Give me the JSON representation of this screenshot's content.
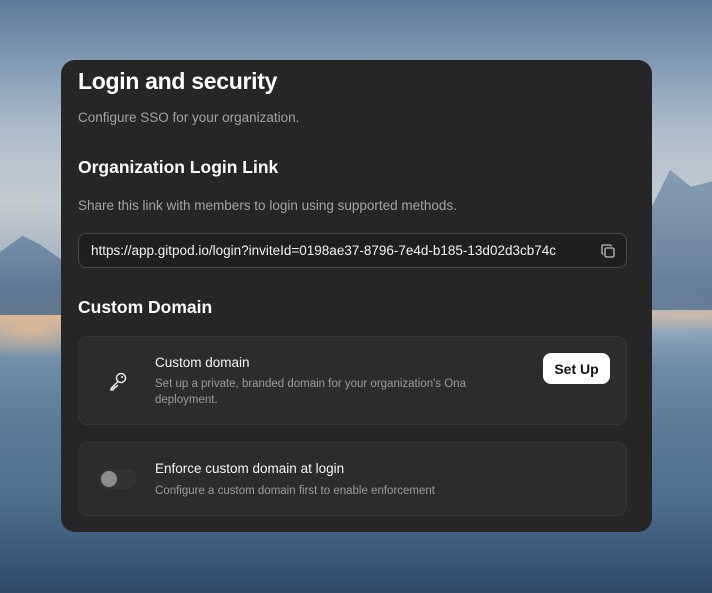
{
  "page": {
    "title": "Login and security",
    "subtitle": "Configure SSO for your organization."
  },
  "login_link": {
    "heading": "Organization Login Link",
    "description": "Share this link with members to login using supported methods.",
    "url": "https://app.gitpod.io/login?inviteId=0198ae37-8796-7e4d-b185-13d02d3cb74c",
    "copy_icon": "copy-icon"
  },
  "custom_domain": {
    "heading": "Custom Domain",
    "card": {
      "icon": "key-icon",
      "title": "Custom domain",
      "description": "Set up a private, branded domain for your organization's Ona deployment.",
      "button_label": "Set Up"
    },
    "enforce": {
      "title": "Enforce custom domain at login",
      "description": "Configure a custom domain first to enable enforcement",
      "enabled": false
    }
  },
  "colors": {
    "card_bg": "#262626",
    "panel_bg": "#2c2c2c",
    "muted_text": "#a3a3a3",
    "button_bg": "#ffffff"
  }
}
